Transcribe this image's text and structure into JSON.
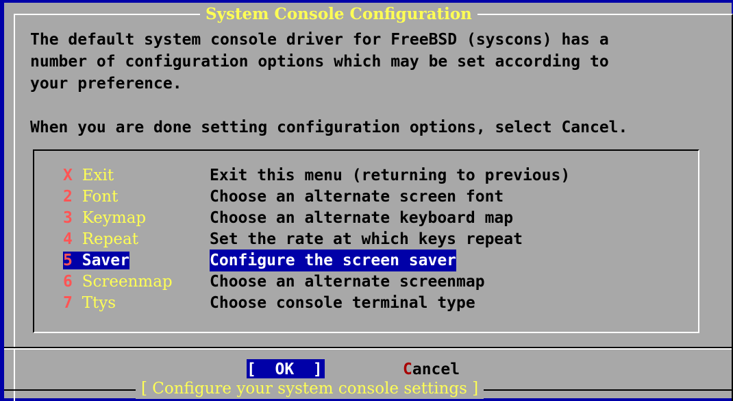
{
  "dialog": {
    "title": "System Console Configuration",
    "description": "The default system console driver for FreeBSD (syscons) has a\nnumber of configuration options which may be set according to\nyour preference.\n\nWhen you are done setting configuration options, select Cancel.",
    "menu": [
      {
        "key": "X",
        "label": "Exit",
        "desc": "Exit this menu (returning to previous)"
      },
      {
        "key": "2",
        "label": "Font",
        "desc": "Choose an alternate screen font"
      },
      {
        "key": "3",
        "label": "Keymap",
        "desc": "Choose an alternate keyboard map"
      },
      {
        "key": "4",
        "label": "Repeat",
        "desc": "Set the rate at which keys repeat"
      },
      {
        "key": "5",
        "label": "Saver",
        "desc": "Configure the screen saver"
      },
      {
        "key": "6",
        "label": "Screenmap",
        "desc": "Choose an alternate screenmap"
      },
      {
        "key": "7",
        "label": "Ttys",
        "desc": "Choose console terminal type"
      }
    ],
    "selected_index": 4,
    "ok_label": "[  OK  ]",
    "cancel_hot": "C",
    "cancel_rest": "ancel",
    "footer": "[ Configure your system console settings ]"
  },
  "colors": {
    "background": "#0000a8",
    "dialog": "#a8a8a8",
    "title": "#ffff54",
    "hotkey": "#ff5454"
  }
}
